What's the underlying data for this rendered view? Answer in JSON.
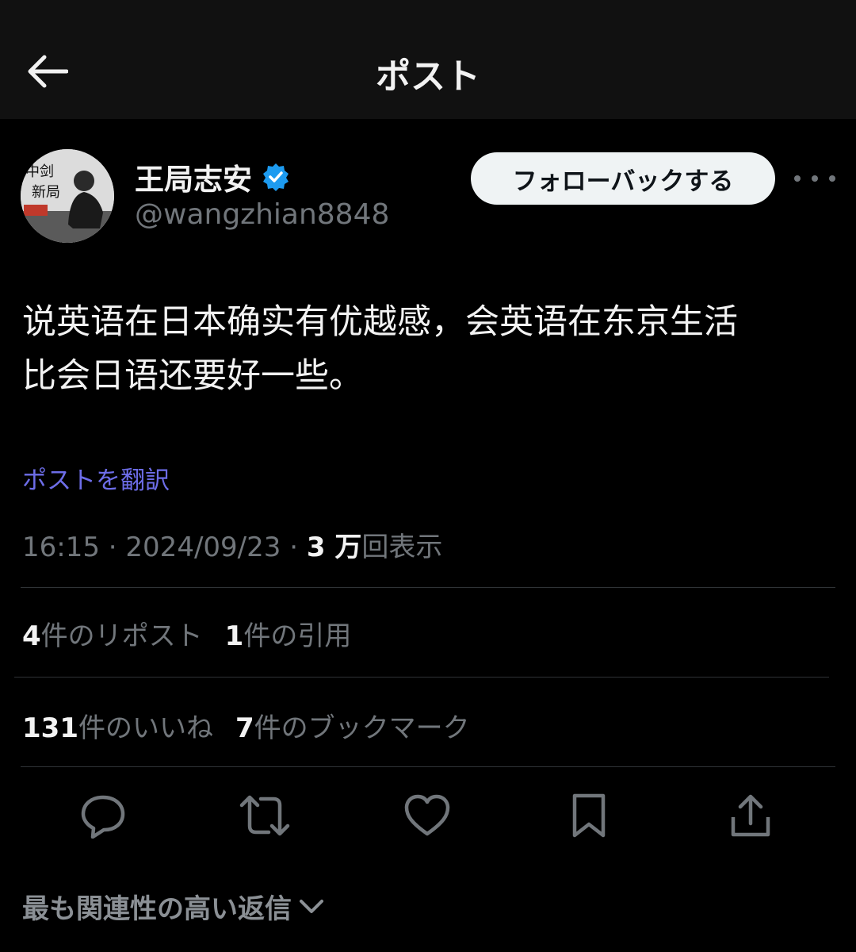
{
  "header": {
    "title": "ポスト",
    "back_icon": "arrow-left-icon"
  },
  "author": {
    "display_name": "王局志安",
    "handle": "@wangzhian8848",
    "verified": true,
    "verified_color": "#1d9bf0",
    "avatar_text": "中剑新局面"
  },
  "follow_button": {
    "label": "フォローバックする"
  },
  "post": {
    "text": "说英语在日本确实有优越感，会英语在东京生活\n比会日语还要好一些。",
    "translate_link": "ポストを翻訳",
    "time": "16:15",
    "date": "2024/09/23",
    "views_count": "3 万",
    "views_label": "回表示"
  },
  "stats": {
    "reposts_count": "4",
    "reposts_label": "件のリポスト",
    "quotes_count": "1",
    "quotes_label": "件の引用",
    "likes_count": "131",
    "likes_label": "件のいいね",
    "bookmarks_count": "7",
    "bookmarks_label": "件のブックマーク"
  },
  "actions": [
    "reply-icon",
    "repost-icon",
    "like-icon",
    "bookmark-icon",
    "share-icon"
  ],
  "relevant_replies": {
    "label": "最も関連性の高い返信"
  },
  "colors": {
    "background": "#000000",
    "header_bg": "#111111",
    "muted_text": "#71767b",
    "link": "#6d6de8",
    "follow_button_bg": "#eff3f4"
  }
}
